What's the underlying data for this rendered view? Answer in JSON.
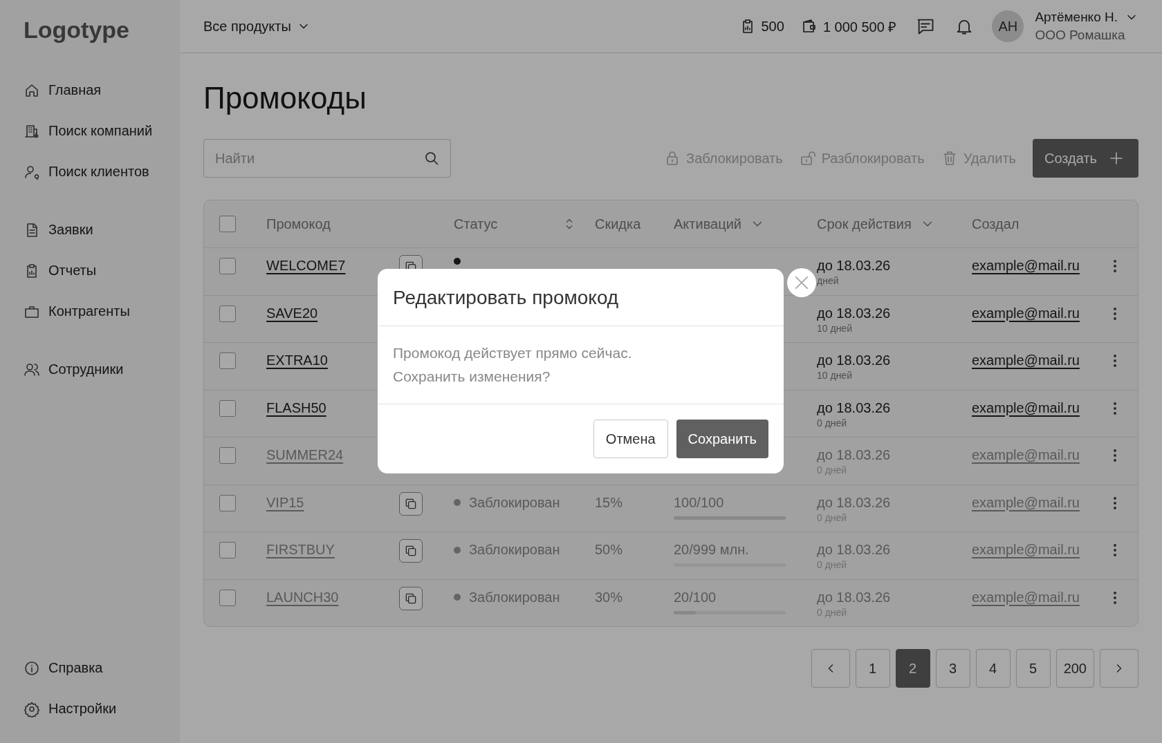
{
  "sidebar": {
    "logo": "Logotype",
    "groups": [
      [
        {
          "label": "Главная"
        },
        {
          "label": "Поиск компаний"
        },
        {
          "label": "Поиск клиентов"
        }
      ],
      [
        {
          "label": "Заявки"
        },
        {
          "label": "Отчеты"
        },
        {
          "label": "Контрагенты"
        }
      ],
      [
        {
          "label": "Сотрудники"
        }
      ]
    ],
    "bottom": [
      {
        "label": "Справка"
      },
      {
        "label": "Настройки"
      }
    ]
  },
  "header": {
    "products": "Все продукты",
    "counter": "500",
    "balance": "1 000 500 ₽",
    "avatar": "АН",
    "user_name": "Артёменко Н.",
    "company": "ООО Ромашка"
  },
  "page": {
    "title": "Промокоды",
    "search": {
      "placeholder": "Найти"
    },
    "actions": [
      {
        "label": "Заблокировать",
        "disabled": true
      },
      {
        "label": "Разблокировать",
        "disabled": true
      },
      {
        "label": "Удалить",
        "disabled": true
      }
    ],
    "create": "Создать"
  },
  "table": {
    "all_checked": false,
    "columns": [
      {
        "label": "Промокод"
      },
      {
        "label": "Статус"
      },
      {
        "label": "Скидка"
      },
      {
        "label": "Активаций"
      },
      {
        "label": "Срок действия"
      },
      {
        "label": "Создал"
      }
    ],
    "rows": [
      {
        "checked": false,
        "code": "WELCOME7",
        "blocked": false,
        "date": "до 18.03.26",
        "days": "дней",
        "creator": "example@mail.ru"
      },
      {
        "checked": false,
        "code": "SAVE20",
        "blocked": false,
        "date": "до 18.03.26",
        "days": "10 дней",
        "creator": "example@mail.ru"
      },
      {
        "checked": false,
        "code": "EXTRA10",
        "blocked": false,
        "date": "до 18.03.26",
        "days": "10 дней",
        "creator": "example@mail.ru"
      },
      {
        "checked": false,
        "code": "FLASH50",
        "blocked": false,
        "date": "до 18.03.26",
        "days": "0 дней",
        "creator": "example@mail.ru"
      },
      {
        "checked": false,
        "code": "SUMMER24",
        "blocked": true,
        "date": "до 18.03.26",
        "days": "0 дней",
        "creator": "example@mail.ru"
      },
      {
        "checked": false,
        "code": "VIP15",
        "blocked": true,
        "status": "Заблокирован",
        "discount": "15%",
        "activations": "100/100",
        "level": 1,
        "date": "до 18.03.26",
        "days": "0 дней",
        "creator": "example@mail.ru"
      },
      {
        "checked": false,
        "code": "FIRSTBUY",
        "blocked": true,
        "status": "Заблокирован",
        "discount": "50%",
        "activations": "20/999 млн.",
        "level": 0,
        "date": "до 18.03.26",
        "days": "0 дней",
        "creator": "example@mail.ru"
      },
      {
        "checked": false,
        "code": "LAUNCH30",
        "blocked": true,
        "status": "Заблокирован",
        "discount": "30%",
        "activations": "20/100",
        "level": 0.2,
        "date": "до 18.03.26",
        "days": "0 дней",
        "creator": "example@mail.ru"
      }
    ]
  },
  "pagination": {
    "pages": [
      {
        "label": "1",
        "selected": false
      },
      {
        "label": "2",
        "selected": true
      },
      {
        "label": "3",
        "selected": false
      },
      {
        "label": "4",
        "selected": false
      },
      {
        "label": "5",
        "selected": false
      },
      {
        "label": "200",
        "selected": false
      }
    ]
  },
  "dialog": {
    "title": "Редактировать промокод",
    "message": "Промокод действует прямо сейчас.\nСохранить изменения?",
    "cancel": "Отмена",
    "confirm": "Сохранить"
  }
}
